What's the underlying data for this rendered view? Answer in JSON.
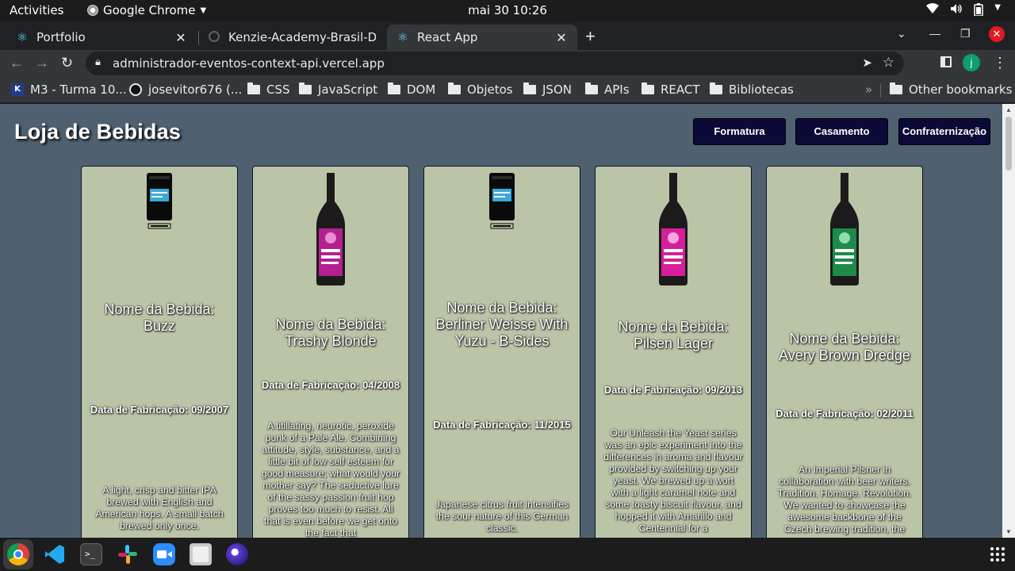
{
  "system": {
    "activities": "Activities",
    "app_name": "Google Chrome",
    "clock": "mai 30  10:26"
  },
  "tabs": [
    {
      "title": "Portfolio"
    },
    {
      "title": "Kenzie-Academy-Brasil-De"
    },
    {
      "title": "React App"
    }
  ],
  "omnibox": {
    "url": "administrador-eventos-context-api.vercel.app"
  },
  "profile_initial": "j",
  "bookmarks": {
    "items": [
      {
        "label": "M3 - Turma 10...",
        "icon": "kenzie-icon"
      },
      {
        "label": "josevitor676 (...",
        "icon": "github-icon"
      },
      {
        "label": "CSS",
        "icon": "folder-icon"
      },
      {
        "label": "JavaScript",
        "icon": "folder-icon"
      },
      {
        "label": "DOM",
        "icon": "folder-icon"
      },
      {
        "label": "Objetos",
        "icon": "folder-icon"
      },
      {
        "label": "JSON",
        "icon": "folder-icon"
      },
      {
        "label": "APIs",
        "icon": "folder-icon"
      },
      {
        "label": "REACT",
        "icon": "folder-icon"
      },
      {
        "label": "Bibliotecas",
        "icon": "folder-icon"
      }
    ],
    "more": "»",
    "other": "Other bookmarks"
  },
  "page": {
    "title": "Loja de Bebidas",
    "buttons": [
      "Formatura",
      "Casamento",
      "Confraternização"
    ],
    "colors": {
      "background": "#4f6170",
      "card": "#bac4a7",
      "button": "#0b0a36"
    }
  },
  "beers": [
    {
      "name": "Nome da Bebida: Buzz",
      "date": "Data de Fabricação: 09/2007",
      "description": "A light, crisp and bitter IPA brewed with English and American hops. A small batch brewed only once.",
      "image": "keg-can",
      "label_color": "#3aa9d8"
    },
    {
      "name": "Nome da Bebida: Trashy Blonde",
      "date": "Data de Fabricação: 04/2008",
      "description": "A titillating, neurotic, peroxide punk of a Pale Ale. Combining attitude, style, substance, and a little bit of low self esteem for good measure; what would your mother say? The seductive lure of the sassy passion fruit hop proves too much to resist. All that is even before we get onto the fact that",
      "image": "bottle",
      "label_color": "#b3208f"
    },
    {
      "name": "Nome da Bebida: Berliner Weisse With Yuzu - B-Sides",
      "date": "Data de Fabricação: 11/2015",
      "description": "Japanese citrus fruit intensifies the sour nature of this German classic.",
      "image": "keg-can",
      "label_color": "#3aa9d8"
    },
    {
      "name": "Nome da Bebida: Pilsen Lager",
      "date": "Data de Fabricação: 09/2013",
      "description": "Our Unleash the Yeast series was an epic experiment into the differences in aroma and flavour provided by switching up your yeast. We brewed up a wort with a light caramel note and some toasty biscuit flavour, and hopped it with Amarillo and Centennial for a",
      "image": "bottle",
      "label_color": "#d61f9a"
    },
    {
      "name": "Nome da Bebida: Avery Brown Dredge",
      "date": "Data de Fabricação: 02/2011",
      "description": "An Imperial Pilsner in collaboration with beer writers. Tradition. Homage. Revolution. We wanted to showcase the awesome backbone of the Czech brewing tradition, the",
      "image": "bottle",
      "label_color": "#1d8a4a"
    }
  ],
  "dock": [
    "chrome-icon",
    "vscode-icon",
    "terminal-icon",
    "slack-icon",
    "zoom-icon",
    "files-icon",
    "screenshot-icon",
    "app-grid-icon"
  ]
}
